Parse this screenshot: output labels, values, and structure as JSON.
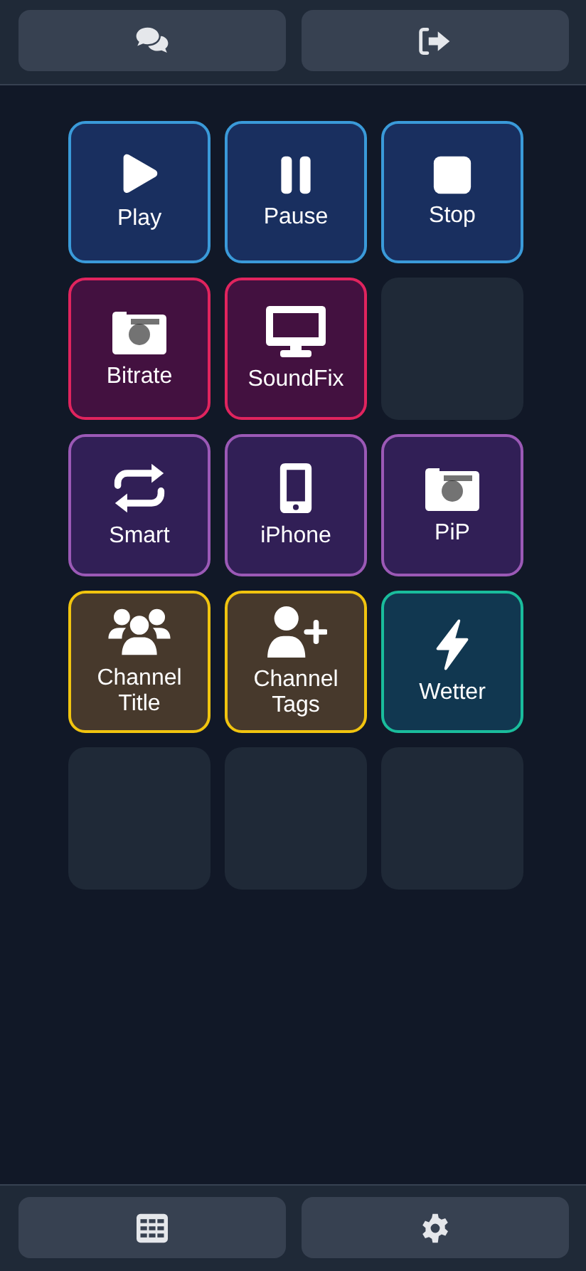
{
  "tiles": [
    {
      "kind": "action",
      "label": "Play",
      "color": "#3a9ad9"
    },
    {
      "kind": "action",
      "label": "Pause",
      "color": "#3a9ad9"
    },
    {
      "kind": "action",
      "label": "Stop",
      "color": "#3a9ad9"
    },
    {
      "kind": "action",
      "label": "Bitrate",
      "color": "#e0245e"
    },
    {
      "kind": "action",
      "label": "SoundFix",
      "color": "#e0245e"
    },
    {
      "kind": "empty"
    },
    {
      "kind": "action",
      "label": "Smart",
      "color": "#9b59b6"
    },
    {
      "kind": "action",
      "label": "iPhone",
      "color": "#9b59b6"
    },
    {
      "kind": "action",
      "label": "PiP",
      "color": "#9b59b6"
    },
    {
      "kind": "action",
      "label": "Channel Title",
      "color": "#f1c40f"
    },
    {
      "kind": "action",
      "label": "Channel Tags",
      "color": "#f1c40f"
    },
    {
      "kind": "action",
      "label": "Wetter",
      "color": "#1abc9c"
    },
    {
      "kind": "empty"
    },
    {
      "kind": "empty"
    },
    {
      "kind": "empty"
    }
  ]
}
